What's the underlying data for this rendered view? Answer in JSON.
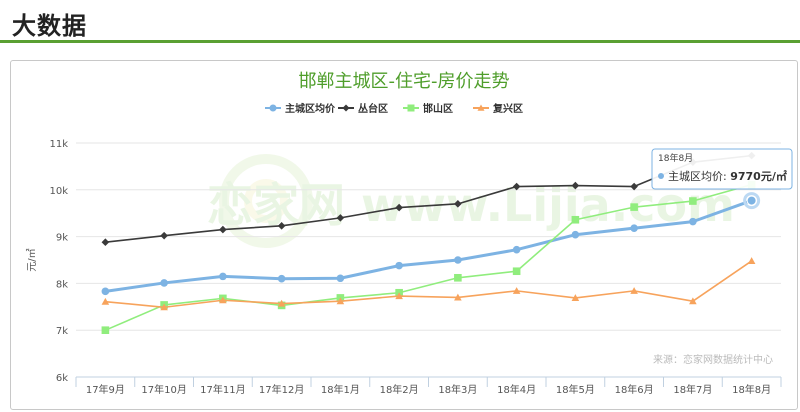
{
  "header": {
    "title": "大数据",
    "accent": "#5aa032"
  },
  "chart_data": {
    "type": "line",
    "title": "邯郸主城区-住宅-房价走势",
    "ylabel": "元/㎡",
    "xlabel": "",
    "ylim": [
      6000,
      11000
    ],
    "yticks": [
      {
        "value": 6000,
        "label": "6k"
      },
      {
        "value": 7000,
        "label": "7k"
      },
      {
        "value": 8000,
        "label": "8k"
      },
      {
        "value": 9000,
        "label": "9k"
      },
      {
        "value": 10000,
        "label": "10k"
      },
      {
        "value": 11000,
        "label": "11k"
      }
    ],
    "categories": [
      "17年9月",
      "17年10月",
      "17年11月",
      "17年12月",
      "18年1月",
      "18年2月",
      "18年3月",
      "18年4月",
      "18年5月",
      "18年6月",
      "18年7月",
      "18年8月"
    ],
    "legend_position": "top-center",
    "grid": true,
    "series": [
      {
        "name": "主城区均价",
        "color": "#7db3e3",
        "marker": "circle",
        "values": [
          7830,
          8010,
          8150,
          8100,
          8110,
          8380,
          8500,
          8720,
          9040,
          9180,
          9320,
          9770
        ]
      },
      {
        "name": "丛台区",
        "color": "#3a3a3a",
        "marker": "diamond",
        "values": [
          8880,
          9020,
          9150,
          9230,
          9400,
          9620,
          9700,
          10070,
          10090,
          10070,
          10590,
          10730
        ]
      },
      {
        "name": "邯山区",
        "color": "#90ed7d",
        "marker": "square",
        "values": [
          7000,
          7540,
          7680,
          7530,
          7690,
          7800,
          8120,
          8260,
          9360,
          9630,
          9760,
          10110
        ]
      },
      {
        "name": "复兴区",
        "color": "#f7a35c",
        "marker": "triangle",
        "values": [
          7610,
          7490,
          7640,
          7570,
          7620,
          7730,
          7700,
          7840,
          7690,
          7840,
          7620,
          8480
        ]
      }
    ],
    "source": "来源：恋家网数据统计中心",
    "tooltip": {
      "time": "18年8月",
      "series_name": "主城区均价",
      "value_text": "9770元/㎡",
      "label_suffix": ":"
    },
    "watermark": "恋家网 www.Lijia.com"
  }
}
